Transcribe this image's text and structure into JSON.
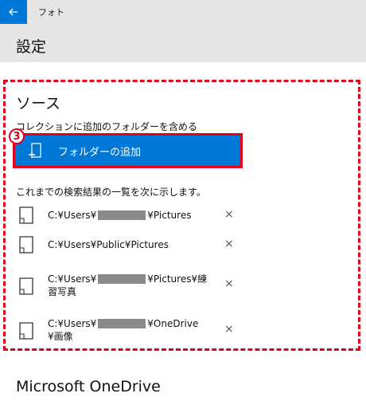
{
  "titlebar": {
    "app_name": "フォト",
    "back_icon": "arrow-left-icon"
  },
  "header": {
    "title": "設定"
  },
  "sources": {
    "title": "ソース",
    "subtitle": "コレクションに追加のフォルダーを含める",
    "step_number": "3",
    "add_button_label": "フォルダーの追加",
    "list_caption": "これまでの検索結果の一覧を次に示します。",
    "remove_glyph": "×",
    "folders": [
      {
        "prefix": "C:¥Users¥",
        "redacted": true,
        "suffix": "¥Pictures",
        "line2": ""
      },
      {
        "prefix": "C:¥Users¥Public¥Pictures",
        "redacted": false,
        "suffix": "",
        "line2": ""
      },
      {
        "prefix": "C:¥Users¥",
        "redacted": true,
        "suffix": "¥Pictures¥練",
        "line2": "習写真"
      },
      {
        "prefix": "C:¥Users¥",
        "redacted": true,
        "suffix": "¥OneDrive",
        "line2": "¥画像"
      }
    ]
  },
  "onedrive": {
    "title": "Microsoft OneDrive"
  },
  "colors": {
    "accent": "#0078d7",
    "highlight": "#e2001a",
    "header_bg": "#e6e6e6"
  }
}
